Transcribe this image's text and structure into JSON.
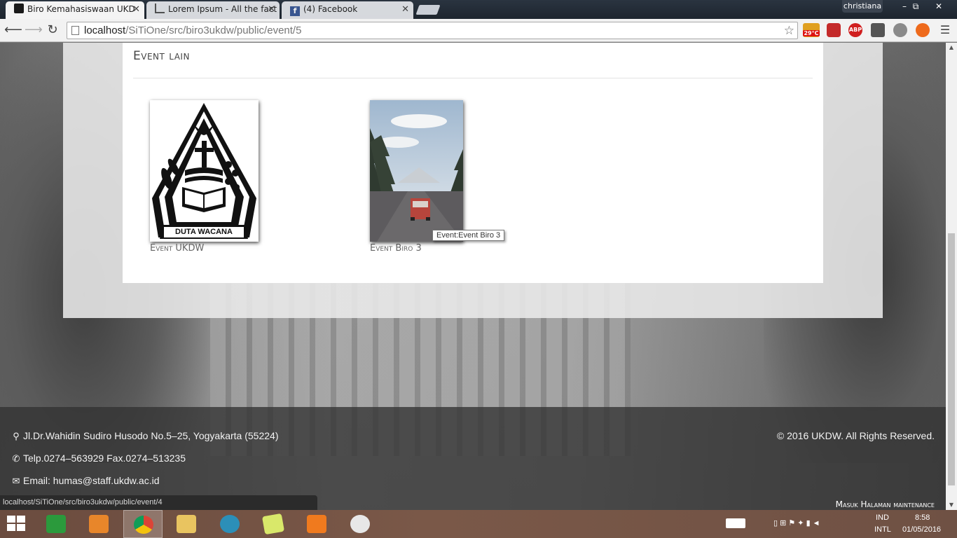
{
  "browser": {
    "tabs": [
      {
        "title": "Biro Kemahasiswaan UKD",
        "active": true
      },
      {
        "title": "Lorem Ipsum - All the fact",
        "active": false
      },
      {
        "title": "(4) Facebook",
        "active": false
      }
    ],
    "profile_name": "christiana",
    "window_controls": [
      "–",
      "⧉",
      "✕"
    ],
    "address": {
      "host": "localhost",
      "path": "/SiTiOne/src/biro3ukdw/public/event/5"
    },
    "weather_badge": "29°C",
    "extensions": [
      "weather-icon",
      "shield-icon",
      "abp-icon",
      "badge-icon",
      "power-icon",
      "rocket-icon"
    ],
    "abp_label": "ABP"
  },
  "page": {
    "section_title": "Event lain",
    "events": [
      {
        "label": "Event UKDW",
        "image": "duta-wacana-logo"
      },
      {
        "label": "Event Biro 3",
        "image": "road-photo"
      }
    ],
    "logo_text": "DUTA WACANA",
    "tooltip": "Event:Event Biro 3",
    "status_url": "localhost/SiTiOne/src/biro3ukdw/public/event/4"
  },
  "footer": {
    "address": "Jl.Dr.Wahidin Sudiro Husodo No.5–25, Yogyakarta (55224)",
    "phone": "Telp.0274–563929 Fax.0274–513235",
    "email": "Email: humas@staff.ukdw.ac.id",
    "copyright": "© 2016 UKDW. All Rights Reserved.",
    "maintenance_link": "Masuk Halaman maintenance"
  },
  "taskbar": {
    "apps": [
      "store",
      "media-player",
      "chrome",
      "file-explorer",
      "network-app",
      "sticky-notes",
      "xampp",
      "snipping-tool"
    ],
    "lang_top": "IND",
    "lang_bottom": "INTL",
    "time": "8:58",
    "date": "01/05/2016"
  },
  "colors": {
    "chrome_frame": "#1d252e",
    "footer_bg": "#323232",
    "taskbar_bg": "#7a5848"
  }
}
